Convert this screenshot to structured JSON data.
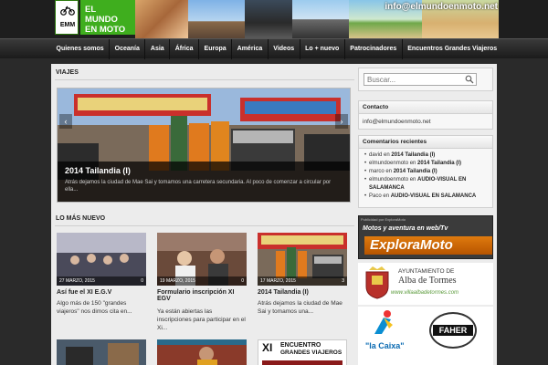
{
  "header": {
    "logo_badge": "EMM",
    "logo_line1": "EL",
    "logo_line2": "MUNDO",
    "logo_line3": "EN MOTO",
    "email": "info@elmundoenmoto.net"
  },
  "nav": {
    "items": [
      "Quienes somos",
      "Oceanía",
      "Asia",
      "África",
      "Europa",
      "América",
      "Videos",
      "Lo + nuevo",
      "Patrocinadores",
      "Encuentros Grandes Viajeros"
    ]
  },
  "main": {
    "viajes_heading": "VIAJES",
    "slide": {
      "title": "2014 Tailandia (I)",
      "excerpt": "Atrás dejamos la ciudad de Mae Sai y tomamos una carretera secundaria. Al poco de comenzar a circular por ella..."
    },
    "latest_heading": "LO MÁS NUEVO",
    "posts": [
      {
        "date": "27 MARZO, 2015",
        "comments": "0",
        "title": "Así fue el XI E.G.V",
        "excerpt": "Algo más de 150 \"grandes viajeros\" nos dimos cita en..."
      },
      {
        "date": "19 MARZO, 2015",
        "comments": "0",
        "title": "Formulario inscripción XI EGV",
        "excerpt": "Ya están abiertas las inscripciones para participar en el Xi..."
      },
      {
        "date": "17 MARZO, 2015",
        "comments": "3",
        "title": "2014 Tailandia (I)",
        "excerpt": "Atrás dejamos la ciudad de Mae Sai y tomamos una..."
      }
    ],
    "poster_lines": [
      "XI",
      "ENCUENTRO",
      "GRANDES VIAJEROS"
    ]
  },
  "sidebar": {
    "search_placeholder": "Buscar...",
    "contact_title": "Contacto",
    "contact_email": "info@elmundoenmoto.net",
    "recent_title": "Comentarios recientes",
    "recent_comments": [
      {
        "author": "david",
        "sep": " en ",
        "post": "2014 Tailandia (I)"
      },
      {
        "author": "elmundoenmoto",
        "sep": " en ",
        "post": "2014 Tailandia (I)"
      },
      {
        "author": "marco",
        "sep": " en ",
        "post": "2014 Tailandia (I)"
      },
      {
        "author": "elmundoenmoto",
        "sep": " en ",
        "post": "AUDIO-VISUAL EN SALAMANCA"
      },
      {
        "author": "Paco",
        "sep": " en ",
        "post": "AUDIO-VISUAL EN SALAMANCA"
      }
    ],
    "ad_explora_small": "Publicidad por ExploraMoto",
    "ad_explora_sub": "Motos y aventura en web/Tv",
    "ad_explora_title": "ExploraMoto",
    "ad_alba_line1": "AYUNTAMIENTO DE",
    "ad_alba_line2": "Alba de Tormes",
    "ad_alba_url": "www.villaalbadetormes.com",
    "ad_caixa": "\"la Caixa\"",
    "ad_faher": "FAHER"
  },
  "colors": {
    "brand_green": "#3fae1e",
    "nav_bg": "#2b2b2b",
    "page_bg": "#ececec",
    "explora_orange": "#e07b0e"
  }
}
